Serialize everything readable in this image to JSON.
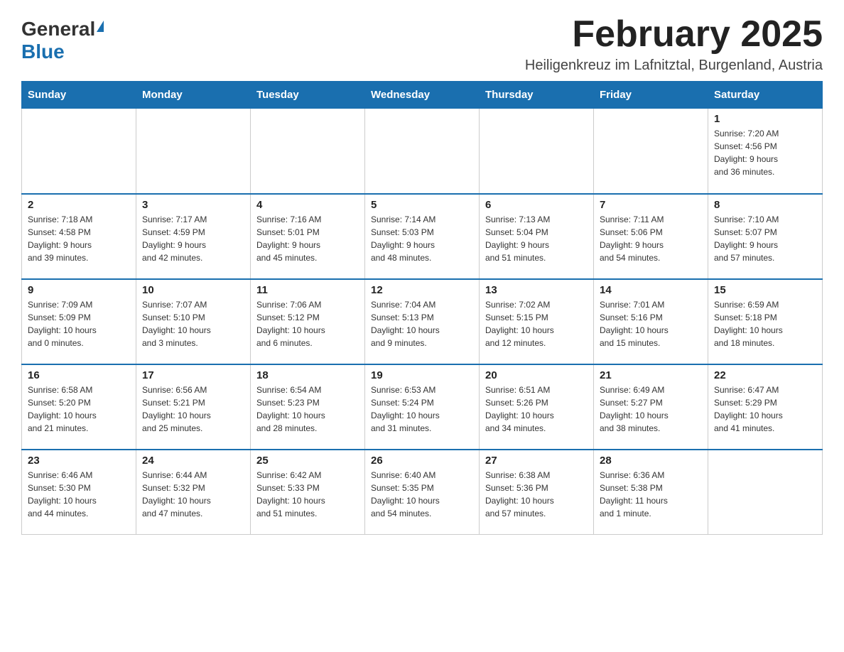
{
  "header": {
    "logo_general": "General",
    "logo_blue": "Blue",
    "month_title": "February 2025",
    "subtitle": "Heiligenkreuz im Lafnitztal, Burgenland, Austria"
  },
  "weekdays": [
    "Sunday",
    "Monday",
    "Tuesday",
    "Wednesday",
    "Thursday",
    "Friday",
    "Saturday"
  ],
  "weeks": [
    [
      {
        "day": "",
        "info": ""
      },
      {
        "day": "",
        "info": ""
      },
      {
        "day": "",
        "info": ""
      },
      {
        "day": "",
        "info": ""
      },
      {
        "day": "",
        "info": ""
      },
      {
        "day": "",
        "info": ""
      },
      {
        "day": "1",
        "info": "Sunrise: 7:20 AM\nSunset: 4:56 PM\nDaylight: 9 hours\nand 36 minutes."
      }
    ],
    [
      {
        "day": "2",
        "info": "Sunrise: 7:18 AM\nSunset: 4:58 PM\nDaylight: 9 hours\nand 39 minutes."
      },
      {
        "day": "3",
        "info": "Sunrise: 7:17 AM\nSunset: 4:59 PM\nDaylight: 9 hours\nand 42 minutes."
      },
      {
        "day": "4",
        "info": "Sunrise: 7:16 AM\nSunset: 5:01 PM\nDaylight: 9 hours\nand 45 minutes."
      },
      {
        "day": "5",
        "info": "Sunrise: 7:14 AM\nSunset: 5:03 PM\nDaylight: 9 hours\nand 48 minutes."
      },
      {
        "day": "6",
        "info": "Sunrise: 7:13 AM\nSunset: 5:04 PM\nDaylight: 9 hours\nand 51 minutes."
      },
      {
        "day": "7",
        "info": "Sunrise: 7:11 AM\nSunset: 5:06 PM\nDaylight: 9 hours\nand 54 minutes."
      },
      {
        "day": "8",
        "info": "Sunrise: 7:10 AM\nSunset: 5:07 PM\nDaylight: 9 hours\nand 57 minutes."
      }
    ],
    [
      {
        "day": "9",
        "info": "Sunrise: 7:09 AM\nSunset: 5:09 PM\nDaylight: 10 hours\nand 0 minutes."
      },
      {
        "day": "10",
        "info": "Sunrise: 7:07 AM\nSunset: 5:10 PM\nDaylight: 10 hours\nand 3 minutes."
      },
      {
        "day": "11",
        "info": "Sunrise: 7:06 AM\nSunset: 5:12 PM\nDaylight: 10 hours\nand 6 minutes."
      },
      {
        "day": "12",
        "info": "Sunrise: 7:04 AM\nSunset: 5:13 PM\nDaylight: 10 hours\nand 9 minutes."
      },
      {
        "day": "13",
        "info": "Sunrise: 7:02 AM\nSunset: 5:15 PM\nDaylight: 10 hours\nand 12 minutes."
      },
      {
        "day": "14",
        "info": "Sunrise: 7:01 AM\nSunset: 5:16 PM\nDaylight: 10 hours\nand 15 minutes."
      },
      {
        "day": "15",
        "info": "Sunrise: 6:59 AM\nSunset: 5:18 PM\nDaylight: 10 hours\nand 18 minutes."
      }
    ],
    [
      {
        "day": "16",
        "info": "Sunrise: 6:58 AM\nSunset: 5:20 PM\nDaylight: 10 hours\nand 21 minutes."
      },
      {
        "day": "17",
        "info": "Sunrise: 6:56 AM\nSunset: 5:21 PM\nDaylight: 10 hours\nand 25 minutes."
      },
      {
        "day": "18",
        "info": "Sunrise: 6:54 AM\nSunset: 5:23 PM\nDaylight: 10 hours\nand 28 minutes."
      },
      {
        "day": "19",
        "info": "Sunrise: 6:53 AM\nSunset: 5:24 PM\nDaylight: 10 hours\nand 31 minutes."
      },
      {
        "day": "20",
        "info": "Sunrise: 6:51 AM\nSunset: 5:26 PM\nDaylight: 10 hours\nand 34 minutes."
      },
      {
        "day": "21",
        "info": "Sunrise: 6:49 AM\nSunset: 5:27 PM\nDaylight: 10 hours\nand 38 minutes."
      },
      {
        "day": "22",
        "info": "Sunrise: 6:47 AM\nSunset: 5:29 PM\nDaylight: 10 hours\nand 41 minutes."
      }
    ],
    [
      {
        "day": "23",
        "info": "Sunrise: 6:46 AM\nSunset: 5:30 PM\nDaylight: 10 hours\nand 44 minutes."
      },
      {
        "day": "24",
        "info": "Sunrise: 6:44 AM\nSunset: 5:32 PM\nDaylight: 10 hours\nand 47 minutes."
      },
      {
        "day": "25",
        "info": "Sunrise: 6:42 AM\nSunset: 5:33 PM\nDaylight: 10 hours\nand 51 minutes."
      },
      {
        "day": "26",
        "info": "Sunrise: 6:40 AM\nSunset: 5:35 PM\nDaylight: 10 hours\nand 54 minutes."
      },
      {
        "day": "27",
        "info": "Sunrise: 6:38 AM\nSunset: 5:36 PM\nDaylight: 10 hours\nand 57 minutes."
      },
      {
        "day": "28",
        "info": "Sunrise: 6:36 AM\nSunset: 5:38 PM\nDaylight: 11 hours\nand 1 minute."
      },
      {
        "day": "",
        "info": ""
      }
    ]
  ]
}
